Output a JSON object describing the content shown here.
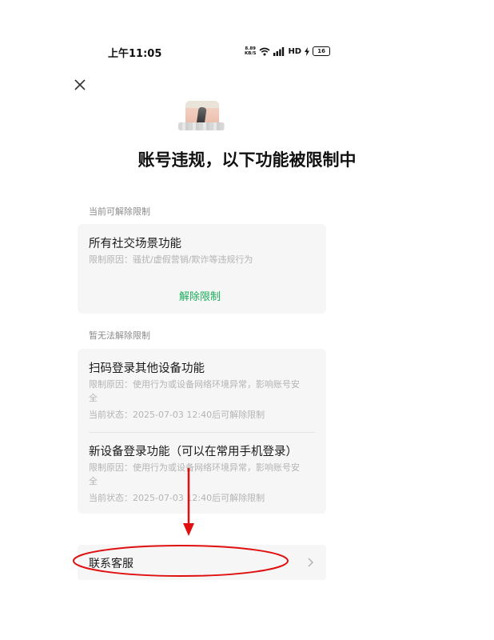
{
  "status_bar": {
    "time": "上午11:05",
    "net_speed_value": "8.89",
    "net_speed_unit": "KB/S",
    "network": "HD",
    "battery": "16"
  },
  "header": {
    "title": "账号违规，以下功能被限制中"
  },
  "removable_section": {
    "label": "当前可解除限制",
    "items": [
      {
        "title": "所有社交场景功能",
        "reason": "限制原因：骚扰/虚假营销/欺诈等违规行为",
        "action": "解除限制"
      }
    ]
  },
  "non_removable_section": {
    "label": "暂无法解除限制",
    "items": [
      {
        "title": "扫码登录其他设备功能",
        "reason_line1": "限制原因：使用行为或设备网络环境异常，影响账号安",
        "reason_line2": "全",
        "status": "当前状态：2025-07-03 12:40后可解除限制"
      },
      {
        "title": "新设备登录功能（可以在常用手机登录）",
        "reason_line1": "限制原因：使用行为或设备网络环境异常，影响账号安",
        "reason_line2": "全",
        "status": "当前状态：2025-07-03 12:40后可解除限制"
      }
    ]
  },
  "contact": {
    "label": "联系客服"
  },
  "colors": {
    "accent_green": "#1aad5a",
    "annotation_red": "#e01010",
    "card_bg": "#f6f6f6"
  }
}
